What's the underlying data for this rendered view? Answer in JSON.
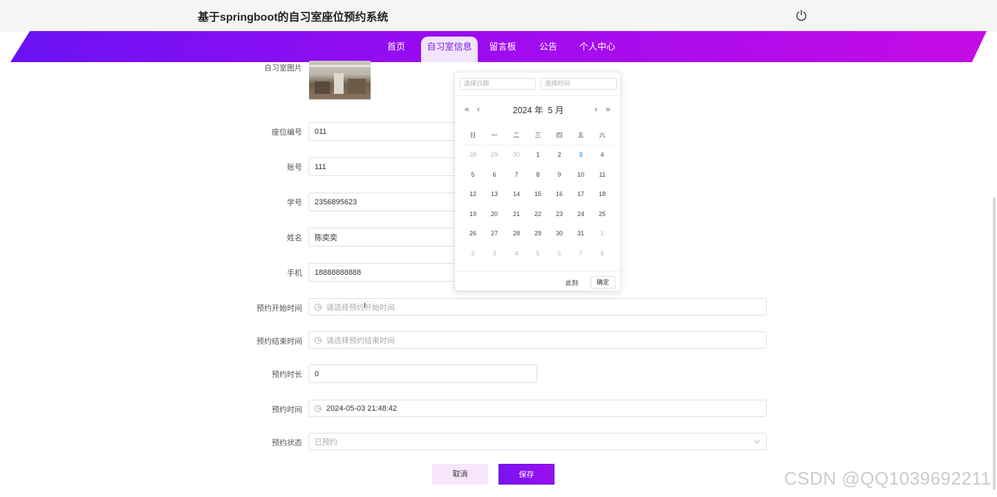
{
  "header": {
    "site_title": "基于springboot的自习室座位预约系统",
    "power_icon": "power-icon"
  },
  "nav": {
    "items": [
      "首页",
      "自习室信息",
      "留言板",
      "公告",
      "个人中心"
    ],
    "active_index": 1
  },
  "form": {
    "photo_label": "自习室图片",
    "seat_label": "座位编号",
    "seat_value": "011",
    "account_label": "账号",
    "account_value": "111",
    "student_id_label": "学号",
    "student_id_value": "2356895623",
    "name_label": "姓名",
    "name_value": "陈奕奕",
    "phone_label": "手机",
    "phone_value": "18888888888",
    "start_label": "预约开始时间",
    "start_placeholder": "请选择预约开始时间",
    "end_label": "预约结束时间",
    "end_placeholder": "请选择预约结束时间",
    "duration_label": "预约时长",
    "duration_value": "0",
    "time_label": "预约时间",
    "time_value": "2024-05-03 21:48:42",
    "status_label": "预约状态",
    "status_value": "已预约",
    "cancel": "取消",
    "save": "保存"
  },
  "picker": {
    "date_placeholder": "选择日期",
    "time_placeholder": "选择时间",
    "year": "2024",
    "year_suffix": "年",
    "month": "5",
    "month_suffix": "月",
    "weekdays": [
      "日",
      "一",
      "二",
      "三",
      "四",
      "五",
      "六"
    ],
    "weeks": [
      [
        "28",
        "29",
        "30",
        "1",
        "2",
        "3",
        "4"
      ],
      [
        "5",
        "6",
        "7",
        "8",
        "9",
        "10",
        "11"
      ],
      [
        "12",
        "13",
        "14",
        "15",
        "16",
        "17",
        "18"
      ],
      [
        "19",
        "20",
        "21",
        "22",
        "23",
        "24",
        "25"
      ],
      [
        "26",
        "27",
        "28",
        "29",
        "30",
        "31",
        "1"
      ],
      [
        "2",
        "3",
        "4",
        "5",
        "6",
        "7",
        "8"
      ]
    ],
    "today": "3",
    "now_label": "此刻",
    "ok_label": "确定"
  },
  "watermark": "CSDN @QQ1039692211",
  "colors": {
    "accent": "#7b18e8",
    "nav_start": "#6a12f4",
    "nav_end": "#c50be6",
    "today": "#409eff"
  }
}
